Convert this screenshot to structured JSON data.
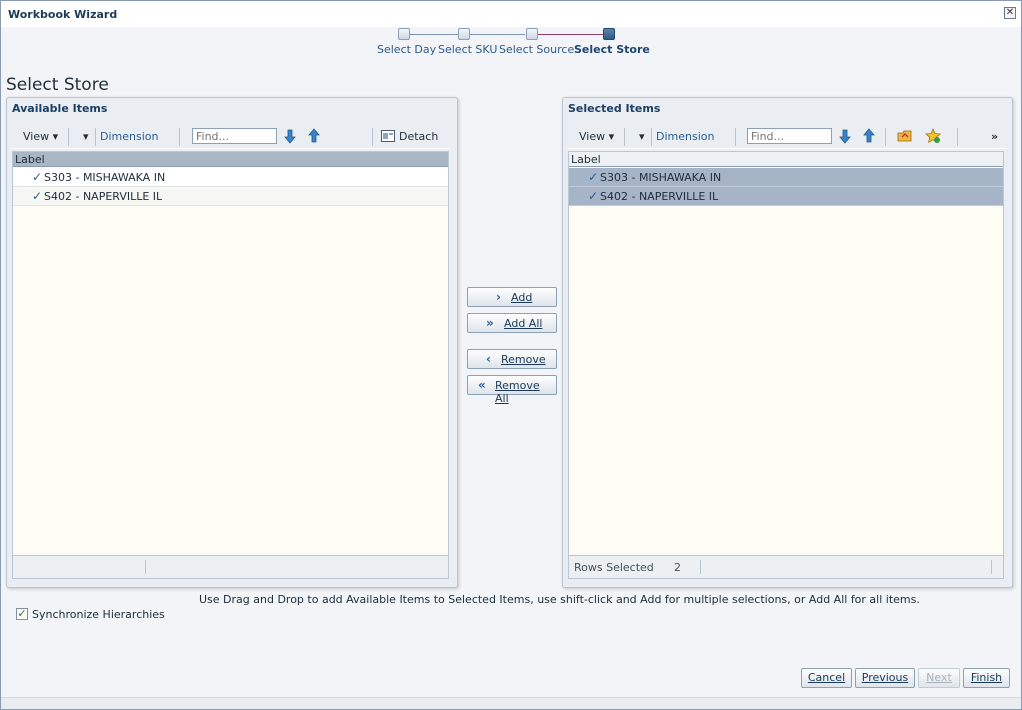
{
  "window": {
    "title": "Workbook Wizard"
  },
  "train": {
    "steps": [
      {
        "label": "Select Day"
      },
      {
        "label": "Select SKU"
      },
      {
        "label": "Select Source"
      },
      {
        "label": "Select Store"
      }
    ],
    "current_step": "Select Store"
  },
  "page": {
    "title": "Select Store"
  },
  "available": {
    "heading": "Available Items",
    "toolbar": {
      "view": "View",
      "dimension": "Dimension",
      "find_placeholder": "Find...",
      "detach": "Detach"
    },
    "column": "Label",
    "rows": [
      "S303 - MISHAWAKA IN",
      "S402 - NAPERVILLE IL"
    ]
  },
  "selected": {
    "heading": "Selected Items",
    "toolbar": {
      "view": "View",
      "dimension": "Dimension",
      "find_placeholder": "Find...",
      "more": "»"
    },
    "column": "Label",
    "rows": [
      "S303 - MISHAWAKA IN",
      "S402 - NAPERVILLE IL"
    ],
    "footer": {
      "rows_selected_label": "Rows Selected",
      "rows_selected_count": "2"
    }
  },
  "shuttle": {
    "add": "Add",
    "add_all": "Add All",
    "remove": "Remove",
    "remove_all": "Remove All"
  },
  "hint": "Use Drag and Drop to add Available Items to Selected Items, use shift-click and Add for multiple selections, or Add All for all items.",
  "sync": {
    "label": "Synchronize Hierarchies",
    "checked": true
  },
  "buttons": {
    "cancel": "Cancel",
    "previous": "Previous",
    "next": "Next",
    "finish": "Finish"
  },
  "colors": {
    "accent": "#2a5d8f",
    "selected_row": "#a6b4c7",
    "train_current": "#2e5a86"
  }
}
